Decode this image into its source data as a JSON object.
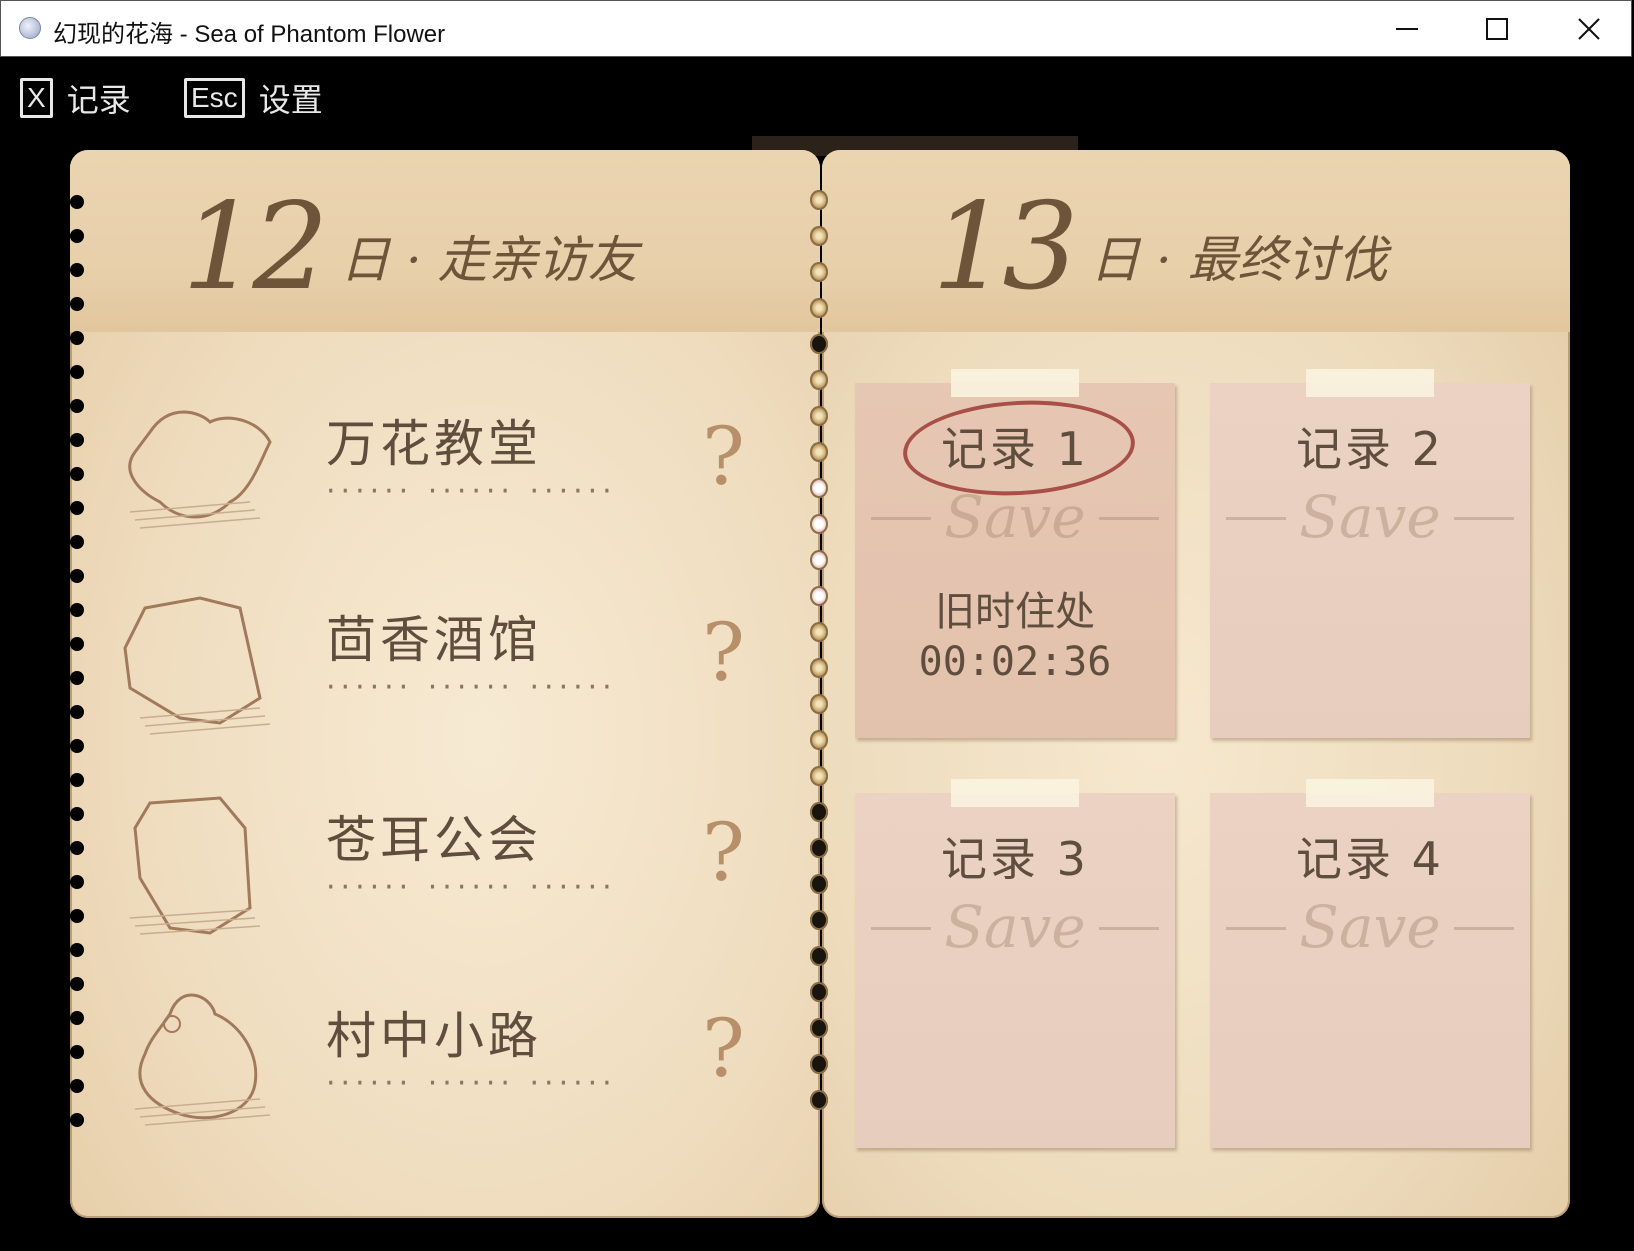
{
  "window": {
    "title": "幻现的花海 - Sea of Phantom Flower"
  },
  "hotkeys": [
    {
      "key": "X",
      "label": "记录"
    },
    {
      "key": "Esc",
      "label": "设置"
    }
  ],
  "left_page": {
    "day_number": "12",
    "day_label": "日 · 走亲访友",
    "locations": [
      {
        "name": "万花教堂",
        "dots": "······ ······ ······",
        "mark": "?"
      },
      {
        "name": "茴香酒馆",
        "dots": "······ ······ ······",
        "mark": "?"
      },
      {
        "name": "苍耳公会",
        "dots": "······ ······ ······",
        "mark": "?"
      },
      {
        "name": "村中小路",
        "dots": "······ ······ ······",
        "mark": "?"
      }
    ]
  },
  "right_page": {
    "day_number": "13",
    "day_label": "日 · 最终讨伐",
    "slots": [
      {
        "title": "记录 1",
        "watermark": "Save",
        "location": "旧时住处",
        "time": "00:02:36"
      },
      {
        "title": "记录 2",
        "watermark": "Save"
      },
      {
        "title": "记录 3",
        "watermark": "Save"
      },
      {
        "title": "记录 4",
        "watermark": "Save"
      }
    ]
  }
}
